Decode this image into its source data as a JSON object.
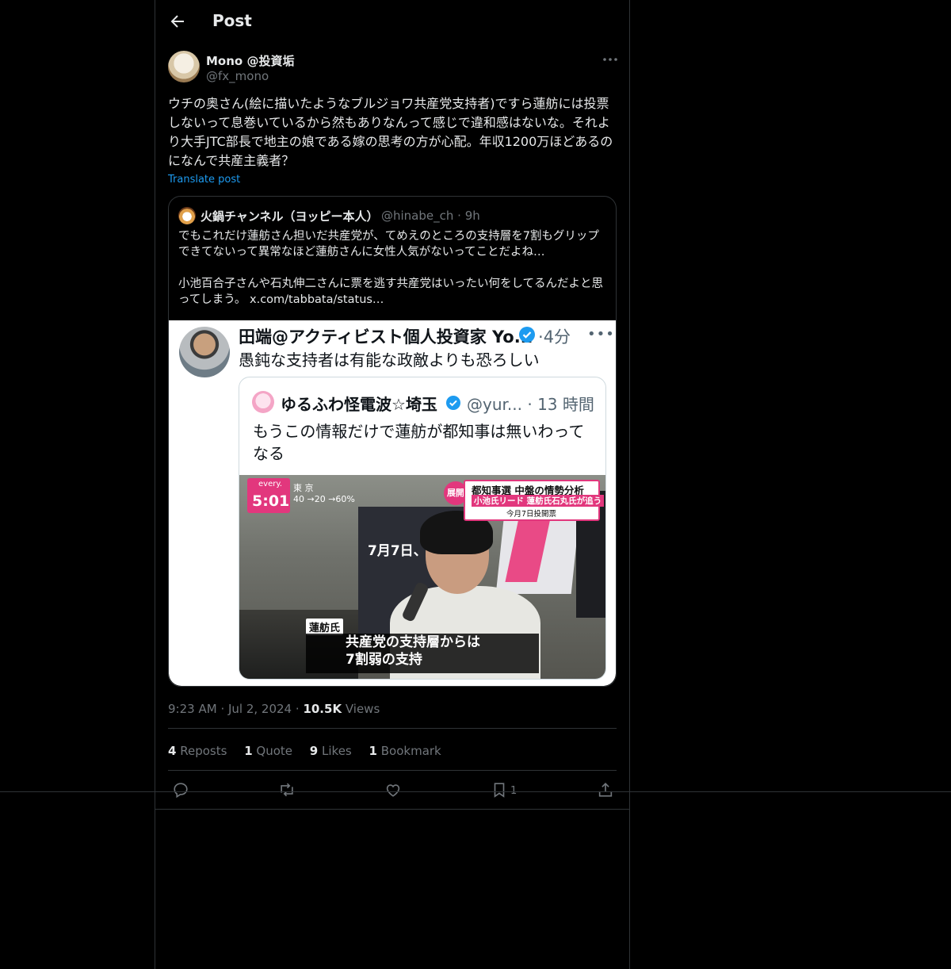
{
  "header": {
    "title": "Post"
  },
  "post": {
    "author_name": "Mono @投資垢",
    "author_handle": "@fx_mono",
    "text": "ウチの奥さん(絵に描いたようなブルジョワ共産党支持者)ですら蓮舫には投票しないって息巻いているから然もありなんって感じで違和感はないな。それより大手JTC部長で地主の娘である嫁の思考の方が心配。年収1200万ほどあるのになんで共産主義者？",
    "translate_label": "Translate post",
    "timestamp": "9:23 AM",
    "date": "Jul 2, 2024",
    "views_count": "10.5K",
    "views_label": "Views"
  },
  "quote": {
    "author_name": "火鍋チャンネル（ヨッピー本人）",
    "author_handle": "@hinabe_ch",
    "time": "9h",
    "text": "でもこれだけ蓮舫さん担いだ共産党が、てめえのところの支持層を7割もグリップできてないって異常なほど蓮舫さんに女性人気がないってことだよね…\n\n小池百合子さんや石丸伸二さんに票を逃す共産党はいったい何をしてるんだよと思ってしまう。 x.com/tabbata/status…",
    "image": {
      "author_name": "田端@アクティビスト個人投資家 Yo...",
      "time": "4分",
      "text": "愚鈍な支持者は有能な政敵よりも恐ろしい",
      "inner": {
        "author_name": "ゆるふわ怪電波☆埼玉",
        "handle": "@yur...",
        "time": "13 時間",
        "text": "もうこの情報だけで蓮舫が都知事は無いわってなる",
        "tv": {
          "channel": "every.",
          "clock": "5:01",
          "weather_city": "東 京",
          "weather_values": "40 →20 →60%",
          "tenkai": "展開",
          "banner_line1": "都知事選 中盤の情勢分析",
          "banner_line2": "小池氏リード 蓮舫氏石丸氏が追う",
          "banner_line3": "今月7日投開票",
          "sign_text": "7月7日、東京都",
          "name_tag": "蓮舫氏",
          "caption_line1": "共産党の支持層からは",
          "caption_line2": "7割弱の支持"
        }
      }
    }
  },
  "stats": {
    "reposts_count": "4",
    "reposts_label": "Reposts",
    "quote_count": "1",
    "quote_label": "Quote",
    "likes_count": "9",
    "likes_label": "Likes",
    "bookmark_count": "1",
    "bookmark_label": "Bookmark"
  },
  "actions": {
    "bookmark_count": "1"
  },
  "icons": {
    "back": "arrow-left-icon",
    "more": "more-horizontal-icon",
    "reply": "reply-icon",
    "repost": "repost-icon",
    "like": "heart-icon",
    "bookmark": "bookmark-icon",
    "share": "share-icon"
  },
  "colors": {
    "background": "#000000",
    "text": "#e7e9ea",
    "muted": "#71767b",
    "link": "#1d9bf0",
    "border": "#2f3336",
    "accent_pink": "#e2377d"
  }
}
